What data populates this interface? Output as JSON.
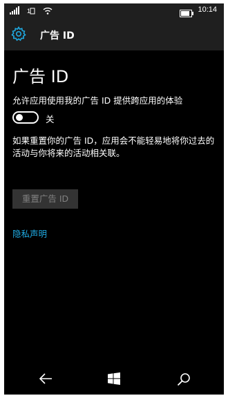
{
  "status_bar": {
    "time": "10:14",
    "icons": [
      "signal-icon",
      "sim-icon",
      "wifi-icon",
      "battery-icon"
    ]
  },
  "header": {
    "icon": "gear-icon",
    "title": "广告 ID"
  },
  "page": {
    "title": "广告 ID",
    "toggle_description": "允许应用使用我的广告 ID 提供跨应用的体验",
    "toggle_state": "关",
    "toggle_on": false,
    "reset_description": "如果重置你的广告 ID，应用会不能轻易地将你过去的活动与你将来的活动相关联。",
    "reset_button": "重置广告 ID",
    "privacy_link": "隐私声明"
  },
  "colors": {
    "accent": "#1fa9e1",
    "background": "#000000",
    "bar": "#1f1f1f",
    "disabled_button": "#333333"
  },
  "nav_bar": {
    "icons": [
      "back-icon",
      "windows-icon",
      "search-icon"
    ]
  }
}
